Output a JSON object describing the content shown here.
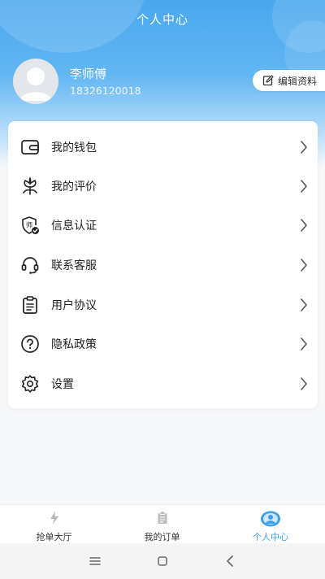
{
  "header": {
    "title": "个人中心"
  },
  "profile": {
    "name": "李师傅",
    "phone": "18326120018",
    "edit_label": "编辑资料"
  },
  "menu": [
    {
      "label": "我的钱包",
      "icon": "wallet-icon"
    },
    {
      "label": "我的评价",
      "icon": "flower-icon"
    },
    {
      "label": "信息认证",
      "icon": "certification-shield-icon"
    },
    {
      "label": "联系客服",
      "icon": "headset-icon"
    },
    {
      "label": "用户协议",
      "icon": "clipboard-icon"
    },
    {
      "label": "隐私政策",
      "icon": "question-circle-icon"
    },
    {
      "label": "设置",
      "icon": "gear-icon"
    }
  ],
  "cert_badge": "师",
  "tabs": [
    {
      "label": "抢单大厅",
      "icon": "lightning-icon",
      "active": false
    },
    {
      "label": "我的订单",
      "icon": "order-list-icon",
      "active": false
    },
    {
      "label": "个人中心",
      "icon": "profile-icon",
      "active": true
    }
  ],
  "colors": {
    "accent": "#3b9ff0",
    "header_top": "#4aa7ee",
    "text": "#222222"
  }
}
